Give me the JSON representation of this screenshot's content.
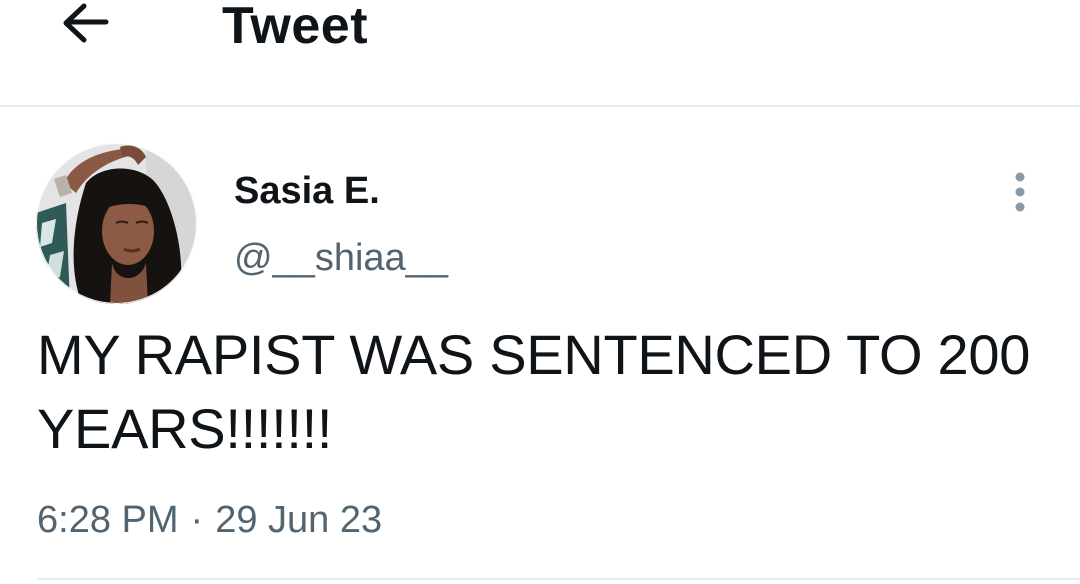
{
  "header": {
    "back_icon": "arrow-left-icon",
    "title": "Tweet"
  },
  "tweet": {
    "author": {
      "display_name": "Sasia E.",
      "handle": "@__shiaa__",
      "avatar": "profile-photo"
    },
    "more_icon": "more-vertical-icon",
    "text": "MY RAPIST WAS SENTENCED TO 200 YEARS!!!!!!!",
    "time": "6:28 PM",
    "separator": "·",
    "date": "29 Jun 23"
  },
  "colors": {
    "text_primary": "#0f1419",
    "text_secondary": "#536471",
    "divider": "#e6ecf0",
    "background": "#ffffff"
  }
}
